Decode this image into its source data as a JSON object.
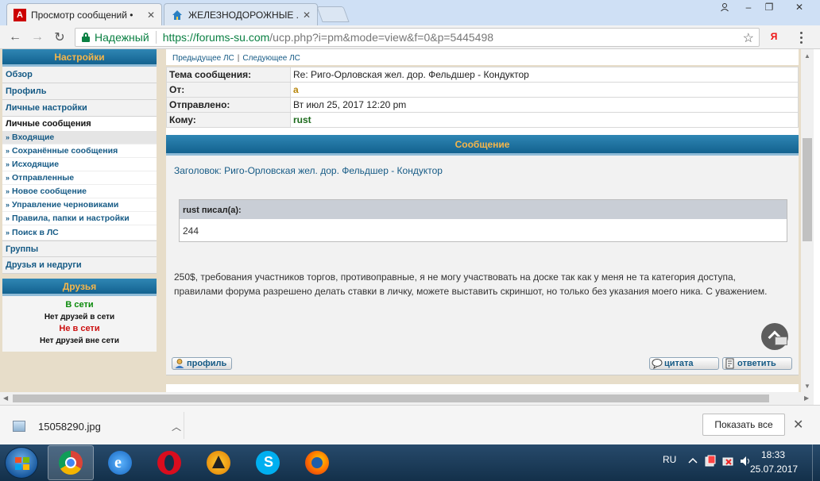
{
  "browser": {
    "tabs": [
      {
        "title": "Просмотр сообщений •",
        "favicon": "A",
        "active": true
      },
      {
        "title": "ЖЕЛЕЗНОДОРОЖНЫЕ ...",
        "favicon": "house",
        "active": false
      }
    ],
    "security_label": "Надежный",
    "url_host": "https://forums-su.com",
    "url_path": "/ucp.php?i=pm&mode=view&f=0&p=5445498",
    "yandex_badge": "Я"
  },
  "sidebar": {
    "settings_header": "Настройки",
    "items": [
      {
        "label": "Обзор"
      },
      {
        "label": "Профиль"
      },
      {
        "label": "Личные настройки"
      }
    ],
    "pm_title": "Личные сообщения",
    "pm_items": [
      {
        "label": "Входящие",
        "selected": true
      },
      {
        "label": "Сохранённые сообщения"
      },
      {
        "label": "Исходящие"
      },
      {
        "label": "Отправленные"
      },
      {
        "label": "Новое сообщение"
      },
      {
        "label": "Управление черновиками"
      },
      {
        "label": "Правила, папки и настройки"
      },
      {
        "label": "Поиск в ЛС"
      }
    ],
    "bottom_items": [
      {
        "label": "Группы"
      },
      {
        "label": "Друзья и недруги"
      }
    ],
    "friends": {
      "header": "Друзья",
      "online_title": "В сети",
      "online_text": "Нет друзей в сети",
      "offline_title": "Не в сети",
      "offline_text": "Нет друзей вне сети"
    }
  },
  "message": {
    "prev": "Предыдущее ЛС",
    "separator": "|",
    "next": "Следующее ЛС",
    "info": [
      {
        "label": "Тема сообщения:",
        "value": "Re: Риго-Орловская жел. дор. Фельдшер - Кондуктор"
      },
      {
        "label": "От:",
        "value": "a"
      },
      {
        "label": "Отправлено:",
        "value": "Вт июл 25, 2017 12:20 pm"
      },
      {
        "label": "Кому:",
        "value": "rust"
      }
    ],
    "section_header": "Сообщение",
    "subject": "Заголовок: Риго-Орловская жел. дор. Фельдшер - Кондуктор",
    "quote_author": "rust писал(а):",
    "quote_text": "244",
    "body": "250$, требования участников торгов, противоправные, я не могу участвовать на доске так как у меня не та категория доступа, правилами форума разрешено делать ставки в личку, можете выставить скриншот, но только без указания моего ника. С уважением.",
    "btn_profile": "профиль",
    "btn_quote": "цитата",
    "btn_reply": "ответить"
  },
  "downloads": {
    "filename": "15058290.jpg",
    "show_all": "Показать все"
  },
  "taskbar": {
    "lang": "RU",
    "time": "18:33",
    "date": "25.07.2017",
    "apps": [
      "chrome",
      "internet-explorer",
      "opera",
      "aimp",
      "skype",
      "firefox"
    ]
  },
  "colors": {
    "header_blue": "#13628f",
    "header_text": "#f6b64a",
    "link": "#155a85",
    "online": "#0b8a0b",
    "offline": "#cc1111"
  }
}
